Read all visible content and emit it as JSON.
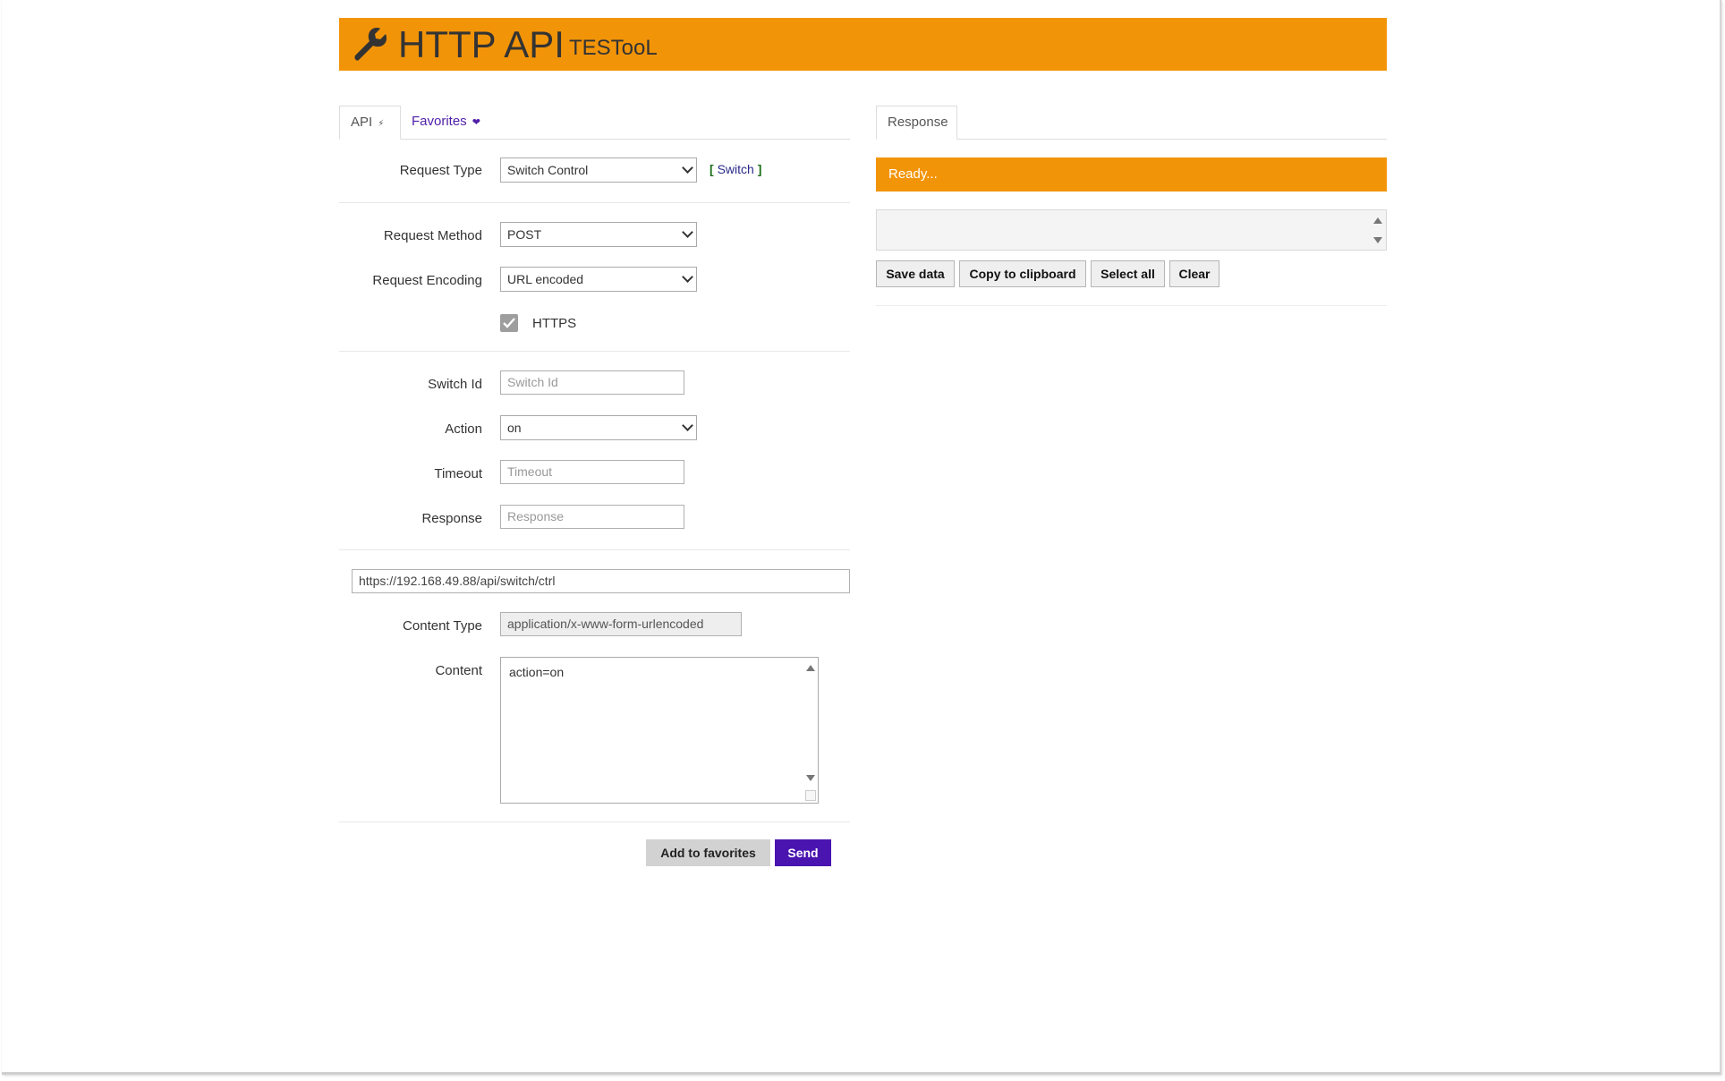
{
  "header": {
    "title": "HTTP API",
    "subtitle": "TESTooL"
  },
  "tabs": {
    "api_label": "API",
    "api_icon": "⚡",
    "favorites_label": "Favorites",
    "favorites_icon": "❤"
  },
  "form": {
    "request_type_label": "Request Type",
    "request_type_value": "Switch Control",
    "switch_link_open": "[",
    "switch_link_text": "Switch",
    "switch_link_close": "]",
    "request_method_label": "Request Method",
    "request_method_value": "POST",
    "request_encoding_label": "Request Encoding",
    "request_encoding_value": "URL encoded",
    "https_label": "HTTPS",
    "https_checked": true,
    "switch_id_label": "Switch Id",
    "switch_id_placeholder": "Switch Id",
    "action_label": "Action",
    "action_value": "on",
    "timeout_label": "Timeout",
    "timeout_placeholder": "Timeout",
    "response_label": "Response",
    "response_placeholder": "Response",
    "url_value": "https://192.168.49.88/api/switch/ctrl",
    "content_type_label": "Content Type",
    "content_type_value": "application/x-www-form-urlencoded",
    "content_label": "Content",
    "content_value": "action=on"
  },
  "actions": {
    "add_favorites": "Add to favorites",
    "send": "Send"
  },
  "response_panel": {
    "tab_label": "Response",
    "status": "Ready...",
    "save_data": "Save data",
    "copy_clipboard": "Copy to clipboard",
    "select_all": "Select all",
    "clear": "Clear"
  },
  "colors": {
    "accent": "#f29408",
    "primary": "#4a14b0",
    "link": "#4f1fa9"
  }
}
